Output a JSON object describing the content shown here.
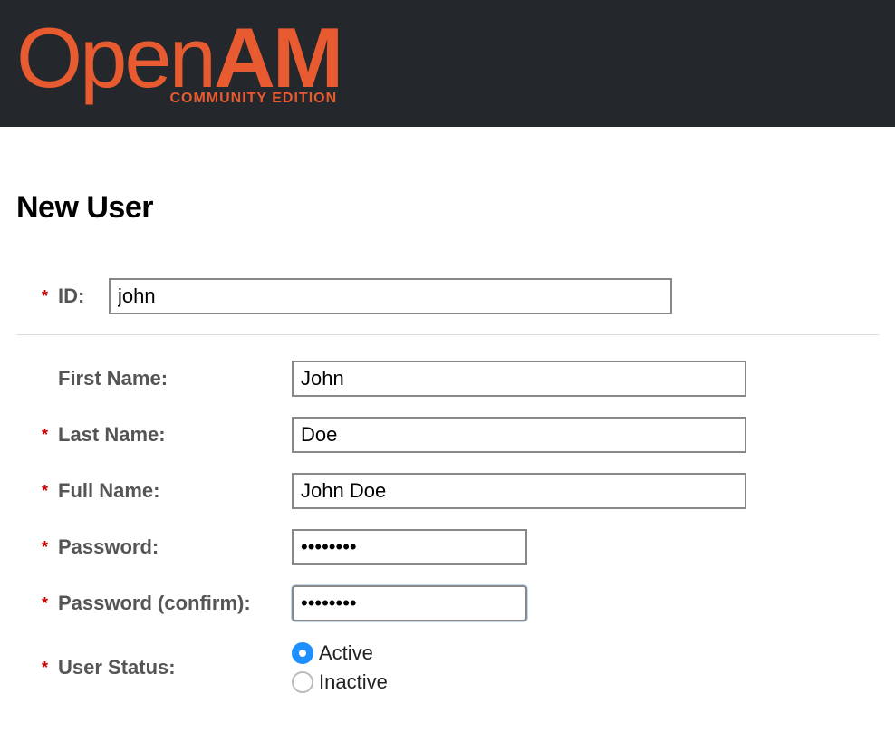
{
  "logo": {
    "prefix": "Open",
    "suffix": "AM",
    "subtitle": "COMMUNITY EDITION"
  },
  "page": {
    "title": "New User"
  },
  "fields": {
    "id": {
      "label": "ID:",
      "value": "john",
      "required": true
    },
    "firstName": {
      "label": "First Name:",
      "value": "John",
      "required": false
    },
    "lastName": {
      "label": "Last Name:",
      "value": "Doe",
      "required": true
    },
    "fullName": {
      "label": "Full Name:",
      "value": "John Doe",
      "required": true
    },
    "password": {
      "label": "Password:",
      "value": "••••••••",
      "required": true
    },
    "passwordConfirm": {
      "label": "Password (confirm):",
      "value": "••••••••",
      "required": true
    },
    "userStatus": {
      "label": "User Status:",
      "required": true,
      "options": {
        "active": "Active",
        "inactive": "Inactive"
      },
      "selected": "active"
    }
  }
}
